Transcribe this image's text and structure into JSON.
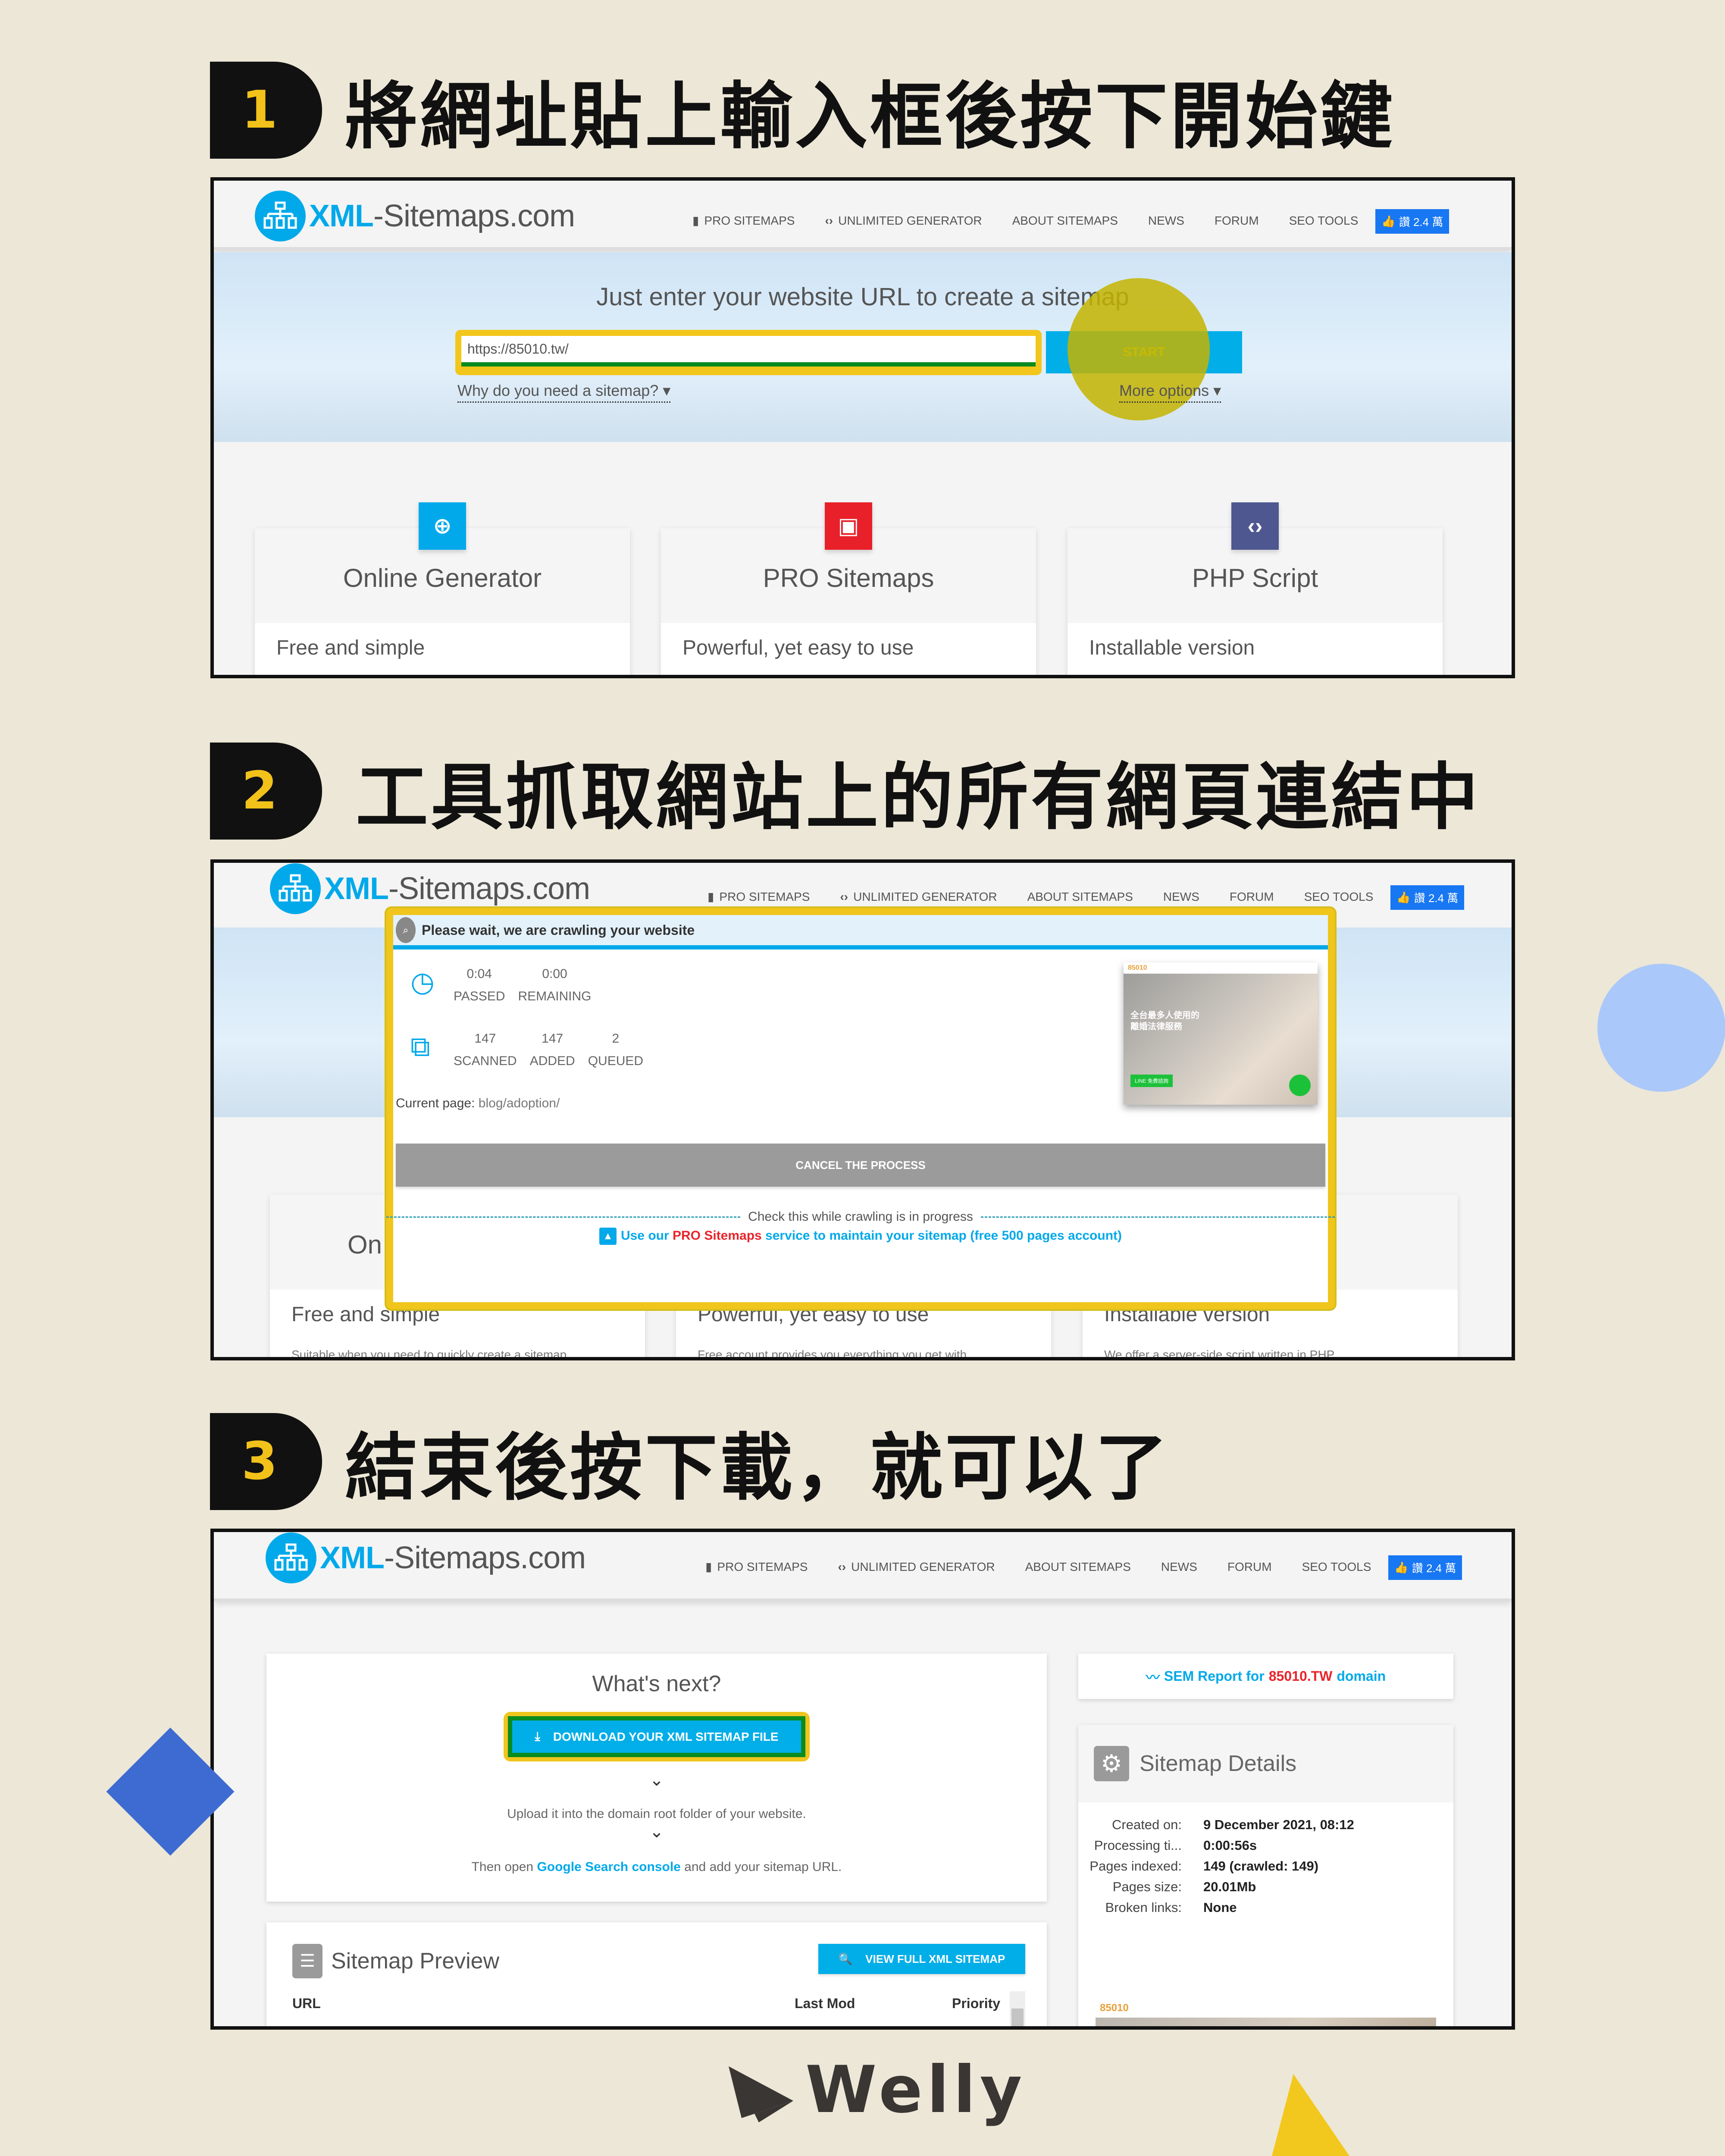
{
  "steps": [
    {
      "number": "1",
      "title": "將網址貼上輸入框後按下開始鍵"
    },
    {
      "number": "2",
      "title": "工具抓取網站上的所有網頁連結中"
    },
    {
      "number": "3",
      "title": "結束後按下載，就可以了"
    }
  ],
  "site": {
    "logo_xml": "XML",
    "logo_rest": "-Sitemaps.com",
    "nav": [
      {
        "label": "PRO SITEMAPS",
        "icon": "pro-icon"
      },
      {
        "label": "UNLIMITED GENERATOR",
        "icon": "code-icon"
      },
      {
        "label": "ABOUT SITEMAPS"
      },
      {
        "label": "NEWS"
      },
      {
        "label": "FORUM"
      },
      {
        "label": "SEO TOOLS"
      }
    ],
    "fb_like": "讚 2.4 萬"
  },
  "step1": {
    "hero_title": "Just enter your website URL to create a sitemap",
    "url_value": "https://85010.tw/",
    "start_label": "START",
    "why_link": "Why do you need a sitemap? ▾",
    "more_options": "More options ▾",
    "cards": [
      {
        "title": "Online Generator",
        "subtitle": "Free and simple",
        "desc": "Suitable when you need to quickly create a sitemap",
        "icon": "globe-icon",
        "color": "#02a9ea"
      },
      {
        "title": "PRO Sitemaps",
        "subtitle": "Powerful, yet easy to use",
        "desc": "Free account provides you everything you get with",
        "icon": "pro-icon",
        "color": "#e8202a"
      },
      {
        "title": "PHP Script",
        "subtitle": "Installable version",
        "desc": "We offer a server-side script written in PHP",
        "icon": "code-icon",
        "color": "#4e5790"
      }
    ]
  },
  "step2": {
    "dialog_title": "Please wait, we are crawling your website",
    "time": [
      {
        "value": "0:04",
        "label": "PASSED"
      },
      {
        "value": "0:00",
        "label": "REMAINING"
      }
    ],
    "pages": [
      {
        "value": "147",
        "label": "SCANNED"
      },
      {
        "value": "147",
        "label": "ADDED"
      },
      {
        "value": "2",
        "label": "QUEUED"
      }
    ],
    "current_page_label": "Current page:",
    "current_page_value": "blog/adoption/",
    "cancel_label": "CANCEL THE PROCESS",
    "check_text": "Check this while crawling is in progress",
    "promo_pre": "Use our ",
    "promo_red": "PRO Sitemaps",
    "promo_post": " service to maintain your sitemap (free 500 pages account)",
    "thumb_brand": "85010",
    "thumb_headline": "全台最多人使用的\n離婚法律服務",
    "thumb_button": "LINE 免費諮詢"
  },
  "step3": {
    "whats_next": "What's next?",
    "download_label": "DOWNLOAD YOUR XML SITEMAP FILE",
    "chevron": "⌄",
    "upload_text": "Upload it into the domain root folder of your website.",
    "then_open_pre": "Then open ",
    "then_open_link": "Google Search console",
    "then_open_post": " and add your sitemap URL.",
    "sem_pre": "SEM Report for ",
    "sem_domain": "85010.TW",
    "sem_post": " domain",
    "details_title": "Sitemap Details",
    "details": [
      {
        "key": "Created on:",
        "value": "9 December 2021, 08:12"
      },
      {
        "key": "Processing ti...",
        "value": "0:00:56s"
      },
      {
        "key": "Pages indexed:",
        "value": "149 (crawled: 149)"
      },
      {
        "key": "Pages size:",
        "value": "20.01Mb"
      },
      {
        "key": "Broken links:",
        "value": "None"
      }
    ],
    "preview_title": "Sitemap Preview",
    "view_full_label": "VIEW FULL XML SITEMAP",
    "columns": [
      "URL",
      "Last Mod",
      "Priority"
    ],
    "thumb_brand": "85010"
  },
  "brand": {
    "name": "Welly"
  },
  "colors": {
    "background": "#ede7d7",
    "accent_blue": "#02a9ea",
    "highlight_yellow": "#f0c51c",
    "highlight_green": "#0a8b1f",
    "promo_red": "#e8252b"
  }
}
